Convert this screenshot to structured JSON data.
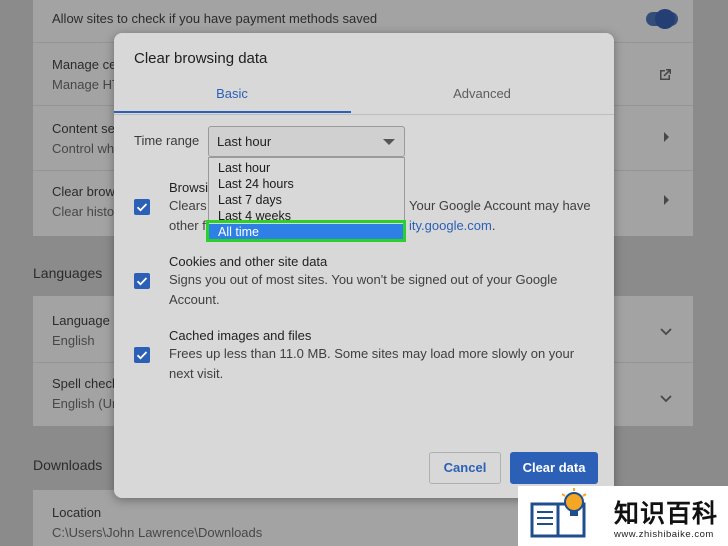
{
  "background": {
    "payment_row": {
      "title": "Allow sites to check if you have payment methods saved"
    },
    "manage_certs": {
      "title": "Manage ce",
      "subtitle": "Manage HT"
    },
    "content_settings": {
      "title": "Content se",
      "subtitle": "Control wha"
    },
    "clear_browsing": {
      "title": "Clear brows",
      "subtitle": "Clear histor"
    },
    "languages_heading": "Languages",
    "language": {
      "title": "Language",
      "subtitle": "English"
    },
    "spellcheck": {
      "title": "Spell check",
      "subtitle": "English (Un"
    },
    "downloads_heading": "Downloads",
    "location": {
      "title": "Location",
      "subtitle": "C:\\Users\\John Lawrence\\Downloads"
    }
  },
  "dialog": {
    "title": "Clear browsing data",
    "tabs": [
      "Basic",
      "Advanced"
    ],
    "time_range": {
      "label": "Time range",
      "value": "Last hour",
      "options": [
        "Last hour",
        "Last 24 hours",
        "Last 7 days",
        "Last 4 weeks",
        "All time"
      ],
      "highlighted": "All time"
    },
    "items": [
      {
        "title": "Browsing history",
        "title_visible": "Browsi",
        "desc_part1": "Clears",
        "desc_part1_right": "Your Google Account may have",
        "desc_part2": "other f",
        "desc_part2_link": "ity.google.com",
        "desc_part2_tail": ".",
        "checked": true
      },
      {
        "title": "Cookies and other site data",
        "desc": "Signs you out of most sites. You won't be signed out of your Google Account.",
        "checked": true
      },
      {
        "title": "Cached images and files",
        "desc": "Frees up less than 11.0 MB. Some sites may load more slowly on your next visit.",
        "checked": true
      }
    ],
    "buttons": {
      "cancel": "Cancel",
      "clear": "Clear data"
    }
  },
  "watermark": {
    "title": "知识百科",
    "url": "www.zhishibaike.com"
  },
  "colors": {
    "accent": "#2c5fb6",
    "highlight_box": "#2bd12b",
    "selected_option": "#2f80e6"
  }
}
